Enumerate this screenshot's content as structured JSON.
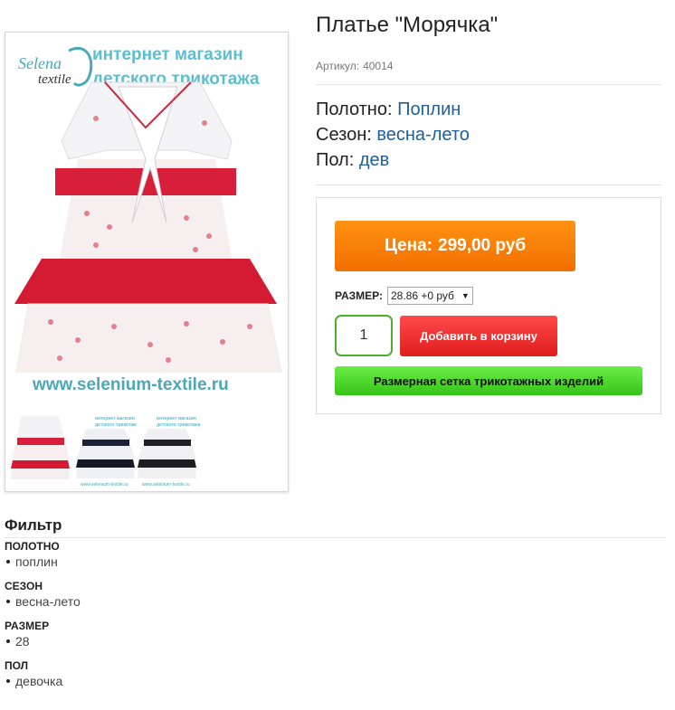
{
  "product": {
    "title": "Платье \"Морячка\"",
    "sku_label": "Артикул:",
    "sku_value": "40014",
    "attributes": [
      {
        "label": "Полотно:",
        "value": "Поплин"
      },
      {
        "label": "Сезон:",
        "value": "весна-лето"
      },
      {
        "label": "Пол:",
        "value": "дев"
      }
    ]
  },
  "image": {
    "banner_line1": "интернет магазин",
    "banner_line2": "детского трикотажа",
    "logo_line1": "Selena",
    "logo_line2": "textile",
    "site_url": "www.selenium-textile.ru",
    "thumb_banner_line1": "интернет магазин",
    "thumb_banner_line2": "детского трикотажа",
    "thumb_url": "www.selenium-textile.ru"
  },
  "buy": {
    "price_label": "Цена:",
    "price_value": "299,00 руб",
    "size_label": "РАЗМЕР:",
    "size_selected": "28.86 +0 руб",
    "quantity": "1",
    "add_to_cart": "Добавить в корзину",
    "size_chart": "Размерная сетка трикотажных изделий"
  },
  "filter": {
    "title": "Фильтр",
    "groups": [
      {
        "heading": "ПОЛОТНО",
        "items": [
          "поплин"
        ]
      },
      {
        "heading": "СЕЗОН",
        "items": [
          "весна-лето"
        ]
      },
      {
        "heading": "РАЗМЕР",
        "items": [
          "28"
        ]
      },
      {
        "heading": "ПОЛ",
        "items": [
          "девочка"
        ]
      }
    ]
  },
  "colors": {
    "price_orange": "#f7820a",
    "add_red": "#ef3333",
    "size_chart_green": "#4fd52d",
    "quantity_border": "#4cae2c",
    "attribute_value_blue": "#1f5fa0",
    "dress_red": "#d81f3a"
  }
}
